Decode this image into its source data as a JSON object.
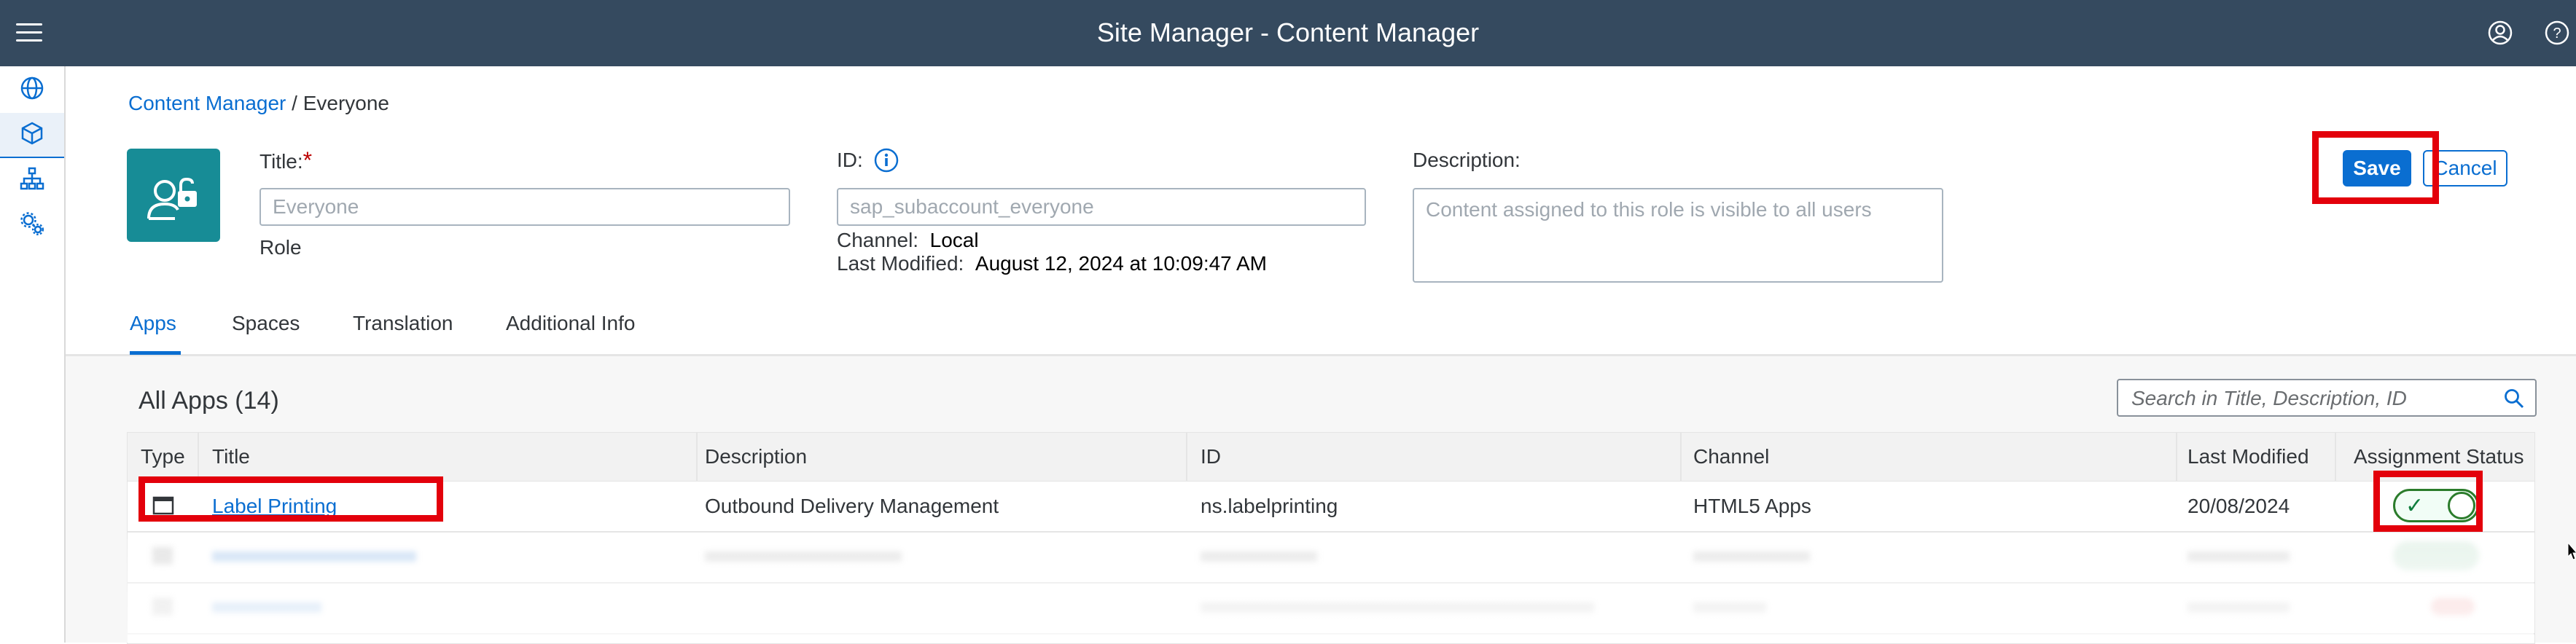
{
  "shell": {
    "title": "Site Manager - Content Manager"
  },
  "breadcrumb": {
    "parent": "Content Manager",
    "separator": " / ",
    "current": "Everyone"
  },
  "role": {
    "title_label": "Title:",
    "required_marker": "*",
    "title_placeholder": "Everyone",
    "type_label": "Role",
    "id_label": "ID:",
    "id_value": "sap_subaccount_everyone",
    "channel_label": "Channel:",
    "channel_value": "Local",
    "last_modified_label": "Last Modified:",
    "last_modified_value": "August 12, 2024 at 10:09:47 AM",
    "description_label": "Description:",
    "description_placeholder": "Content assigned to this role is visible to all users"
  },
  "actions": {
    "save_label": "Save",
    "cancel_label": "Cancel"
  },
  "tabs": [
    {
      "label": "Apps",
      "active": true
    },
    {
      "label": "Spaces",
      "active": false
    },
    {
      "label": "Translation",
      "active": false
    },
    {
      "label": "Additional Info",
      "active": false
    }
  ],
  "apps_table": {
    "title": "All Apps (14)",
    "search_placeholder": "Search in Title, Description, ID",
    "columns": [
      "Type",
      "Title",
      "Description",
      "ID",
      "Channel",
      "Last Modified",
      "Assignment Status"
    ],
    "rows": [
      {
        "title": "Label Printing",
        "description": "Outbound Delivery Management",
        "id": "ns.labelprinting",
        "channel": "HTML5 Apps",
        "last_modified": "20/08/2024",
        "assigned": true
      }
    ]
  },
  "colors": {
    "shell_bar": "#354a5f",
    "brand_blue": "#0a6ed1",
    "avatar_teal": "#178c96",
    "highlight_red": "#e3000b",
    "toggle_green": "#2b7c2b"
  },
  "icons": {
    "menu": "hamburger-icon",
    "profile": "user-circle-icon",
    "help": "help-icon",
    "nav": [
      "globe-icon",
      "cube-icon",
      "hierarchy-icon",
      "settings-icon"
    ],
    "role_avatar": "user-unlock-icon",
    "info": "info-icon",
    "search": "search-icon",
    "app_type": "app-window-icon"
  }
}
